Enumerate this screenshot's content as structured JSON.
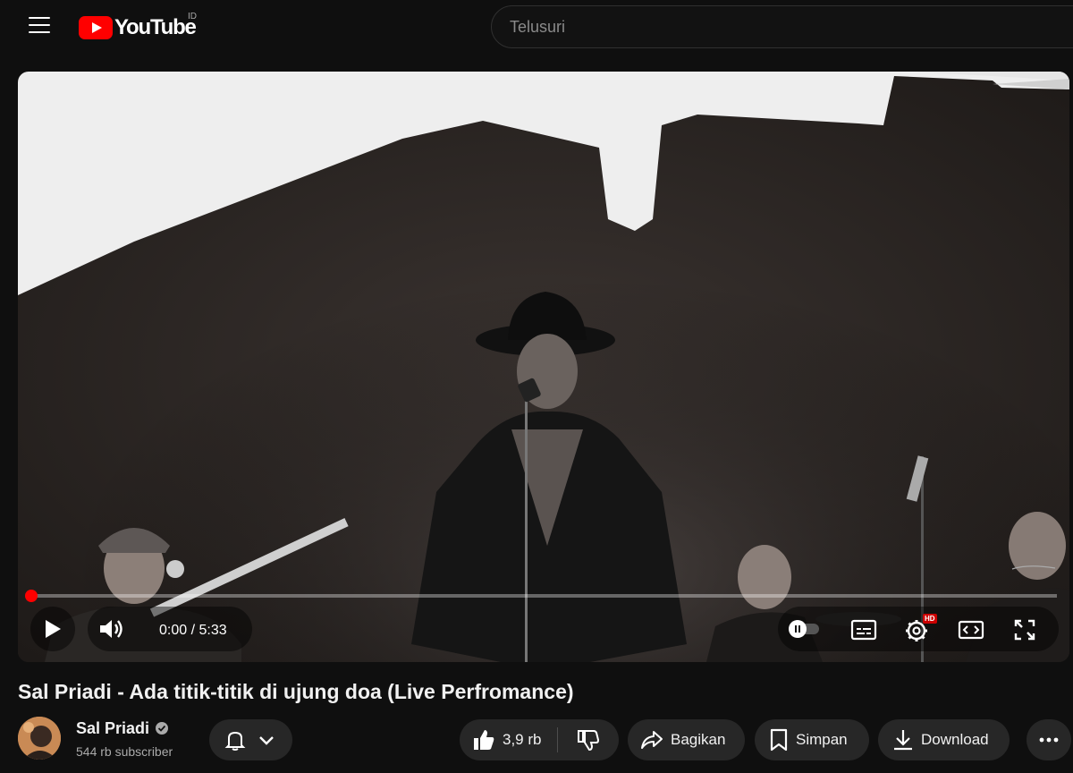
{
  "header": {
    "logo_text": "YouTube",
    "region": "ID",
    "search_placeholder": "Telusuri"
  },
  "player": {
    "time_current": "0:00",
    "time_separator": "/",
    "time_total": "5:33",
    "progress_fraction": 0.0,
    "hd_badge": "HD",
    "colors": {
      "progress": "#ff0000",
      "hd_badge": "#cc0000"
    }
  },
  "video": {
    "title": "Sal Priadi - Ada titik-titik di ujung doa (Live Perfromance)"
  },
  "channel": {
    "name": "Sal Priadi",
    "subscribers": "544 rb subscriber"
  },
  "actions": {
    "likes": "3,9 rb",
    "share_label": "Bagikan",
    "save_label": "Simpan",
    "download_label": "Download"
  },
  "icons": [
    "menu-icon",
    "youtube-logo-icon",
    "play-icon",
    "volume-icon",
    "autoplay-toggle-icon",
    "subtitles-icon",
    "settings-icon",
    "theater-mode-icon",
    "fullscreen-icon",
    "bell-icon",
    "chevron-down-icon",
    "thumbs-up-icon",
    "thumbs-down-icon",
    "share-icon",
    "bookmark-icon",
    "download-icon",
    "more-icon",
    "verified-icon"
  ]
}
